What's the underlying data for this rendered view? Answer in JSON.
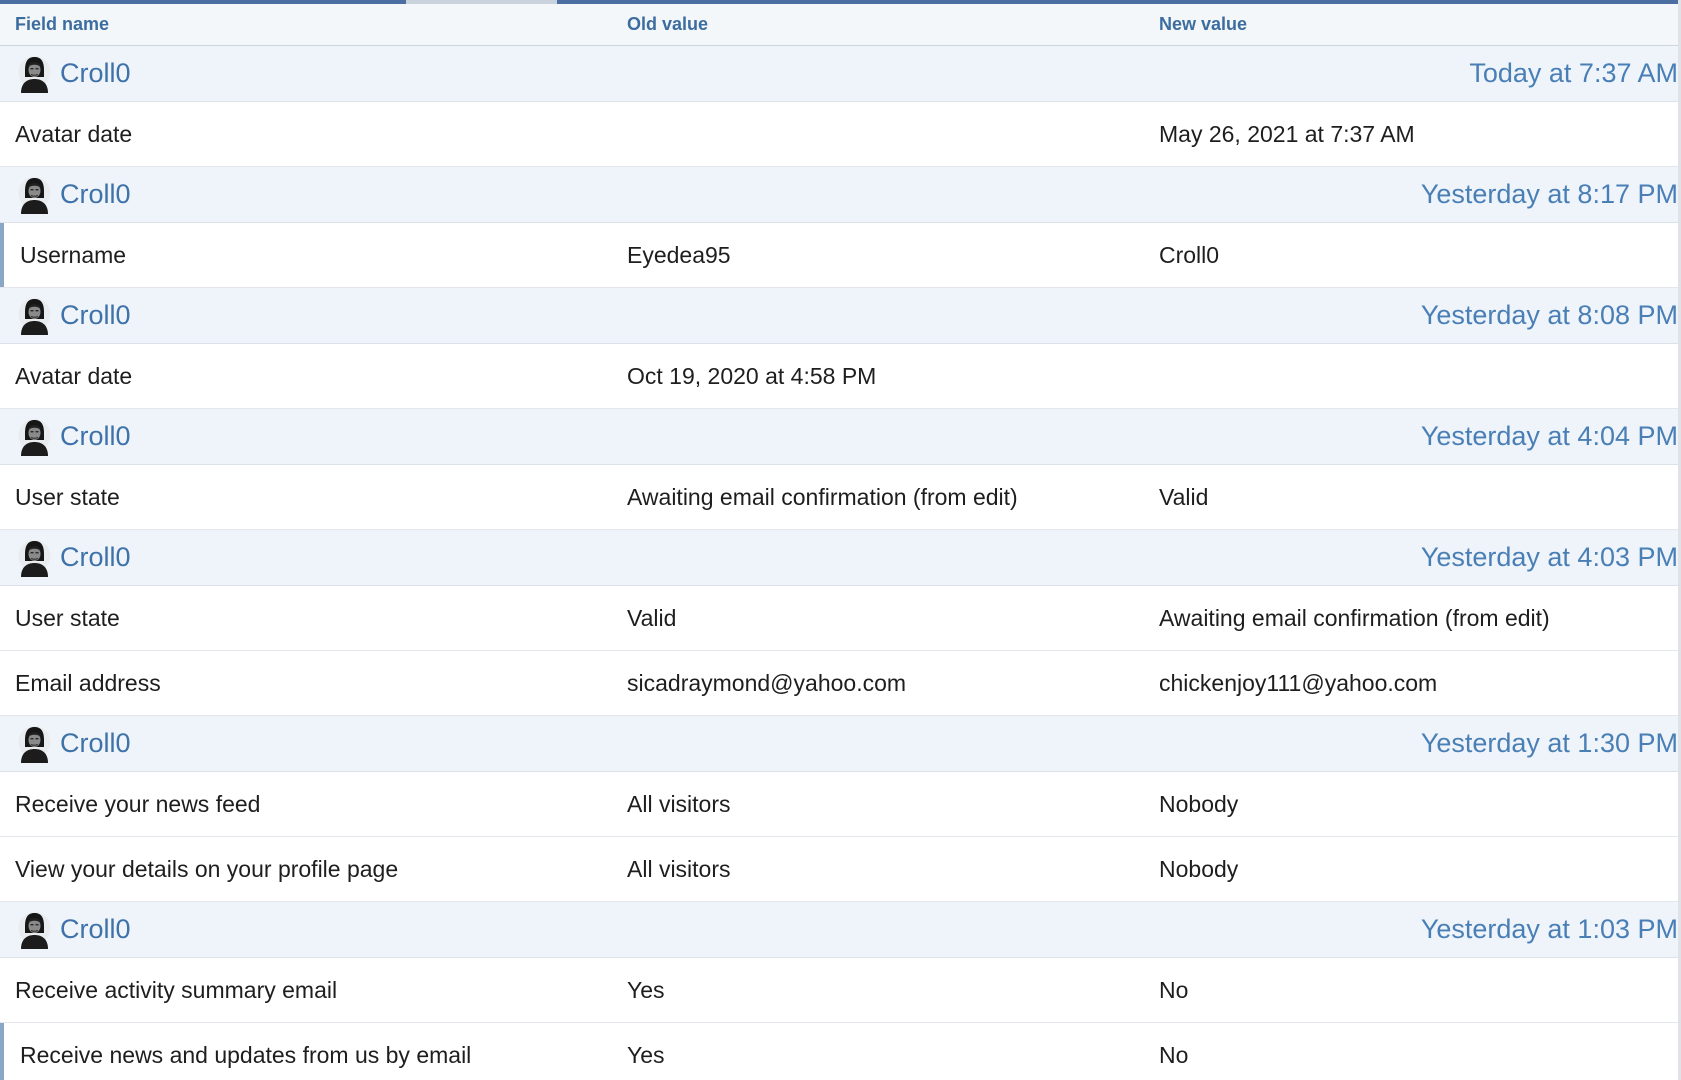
{
  "header": {
    "field_name": "Field name",
    "old_value": "Old value",
    "new_value": "New value"
  },
  "accent_colors": {
    "link": "#3f72a8",
    "header_text": "#3c6d9f",
    "group_bg": "#eef4fa"
  },
  "groups": [
    {
      "user": "Croll0",
      "time": "Today at 7:37 AM",
      "changes": [
        {
          "field": "Avatar date",
          "old": "",
          "new": "May 26, 2021 at 7:37 AM"
        }
      ]
    },
    {
      "user": "Croll0",
      "time": "Yesterday at 8:17 PM",
      "changes": [
        {
          "field": "Username",
          "old": "Eyedea95",
          "new": "Croll0"
        }
      ]
    },
    {
      "user": "Croll0",
      "time": "Yesterday at 8:08 PM",
      "changes": [
        {
          "field": "Avatar date",
          "old": "Oct 19, 2020 at 4:58 PM",
          "new": ""
        }
      ]
    },
    {
      "user": "Croll0",
      "time": "Yesterday at 4:04 PM",
      "changes": [
        {
          "field": "User state",
          "old": "Awaiting email confirmation (from edit)",
          "new": "Valid"
        }
      ]
    },
    {
      "user": "Croll0",
      "time": "Yesterday at 4:03 PM",
      "changes": [
        {
          "field": "User state",
          "old": "Valid",
          "new": "Awaiting email confirmation (from edit)"
        },
        {
          "field": "Email address",
          "old": "sicadraymond@yahoo.com",
          "new": "chickenjoy111@yahoo.com"
        }
      ]
    },
    {
      "user": "Croll0",
      "time": "Yesterday at 1:30 PM",
      "changes": [
        {
          "field": "Receive your news feed",
          "old": "All visitors",
          "new": "Nobody"
        },
        {
          "field": "View your details on your profile page",
          "old": "All visitors",
          "new": "Nobody"
        }
      ]
    },
    {
      "user": "Croll0",
      "time": "Yesterday at 1:03 PM",
      "changes": [
        {
          "field": "Receive activity summary email",
          "old": "Yes",
          "new": "No"
        },
        {
          "field": "Receive news and updates from us by email",
          "old": "Yes",
          "new": "No"
        }
      ]
    }
  ]
}
